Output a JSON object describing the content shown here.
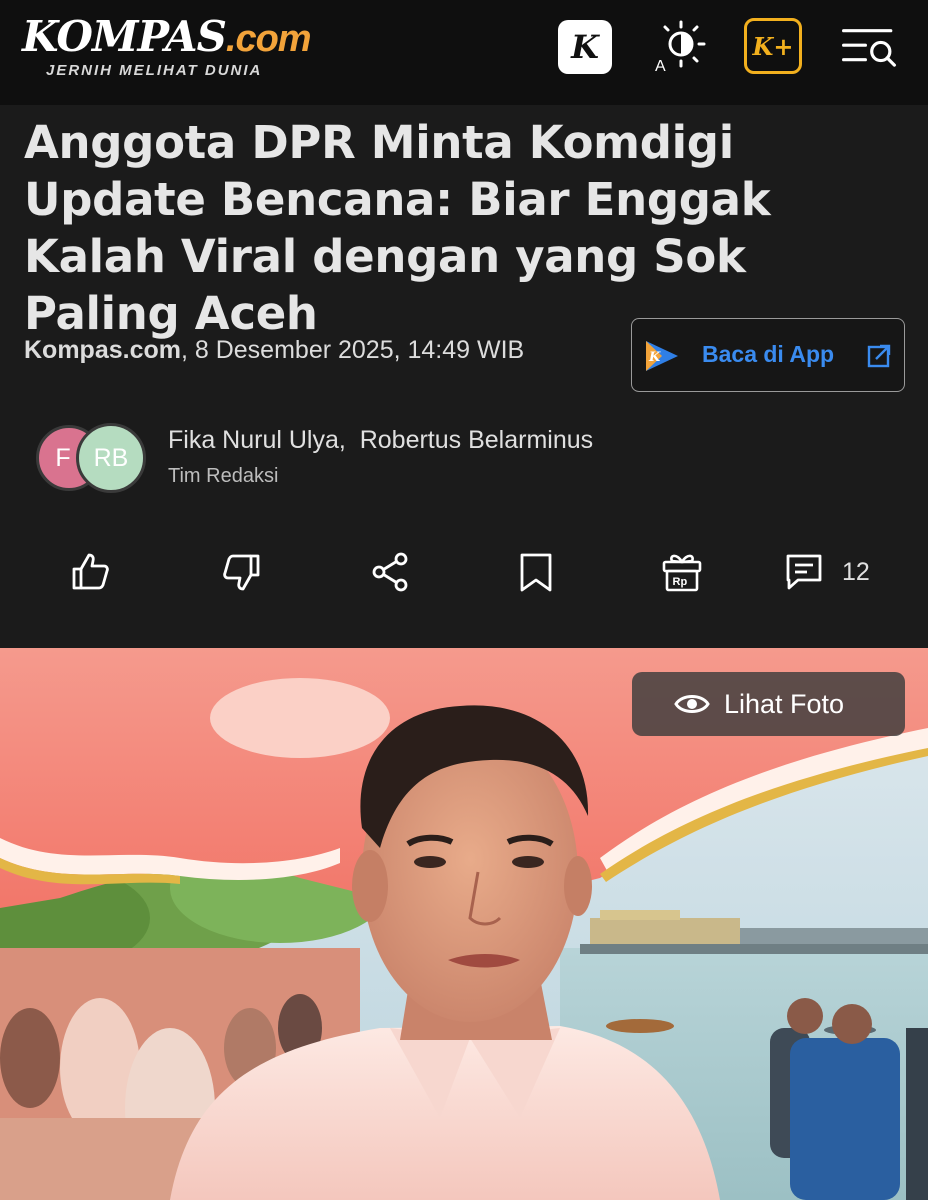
{
  "header": {
    "logo_text": "KOMPAS",
    "logo_suffix": ".com",
    "logo_tagline": "JERNIH MELIHAT DUNIA",
    "icons": [
      "kompas-k-icon",
      "theme-toggle-icon",
      "kompas-plus-icon",
      "menu-search-icon"
    ],
    "k_label": "K",
    "kplus_label": "K+"
  },
  "article": {
    "title": "Anggota DPR Minta Komdigi Update Bencana: Biar Enggak Kalah Viral dengan yang Sok Paling Aceh",
    "source": "Kompas.com",
    "date": ", 8 Desember 2025, 14:49 WIB"
  },
  "app_button": {
    "label": "Baca di App",
    "accent": "#3a8bef"
  },
  "authors": {
    "avatar_1": "F",
    "avatar_2": "RB",
    "names": "Fika Nurul Ulya,  Robertus Belarminus",
    "team": "Tim Redaksi"
  },
  "actions": {
    "items": [
      "like-icon",
      "dislike-icon",
      "share-icon",
      "bookmark-icon",
      "gift-icon",
      "comment-icon"
    ],
    "gift_label": "Rp",
    "comment_count": "12"
  },
  "photo": {
    "view_label": "Lihat Foto"
  },
  "colors": {
    "header_bg": "#0f0f0f",
    "page_bg": "#1b1b1b",
    "brand_orange": "#f2a33a",
    "kplus_gold": "#f2b01e"
  }
}
